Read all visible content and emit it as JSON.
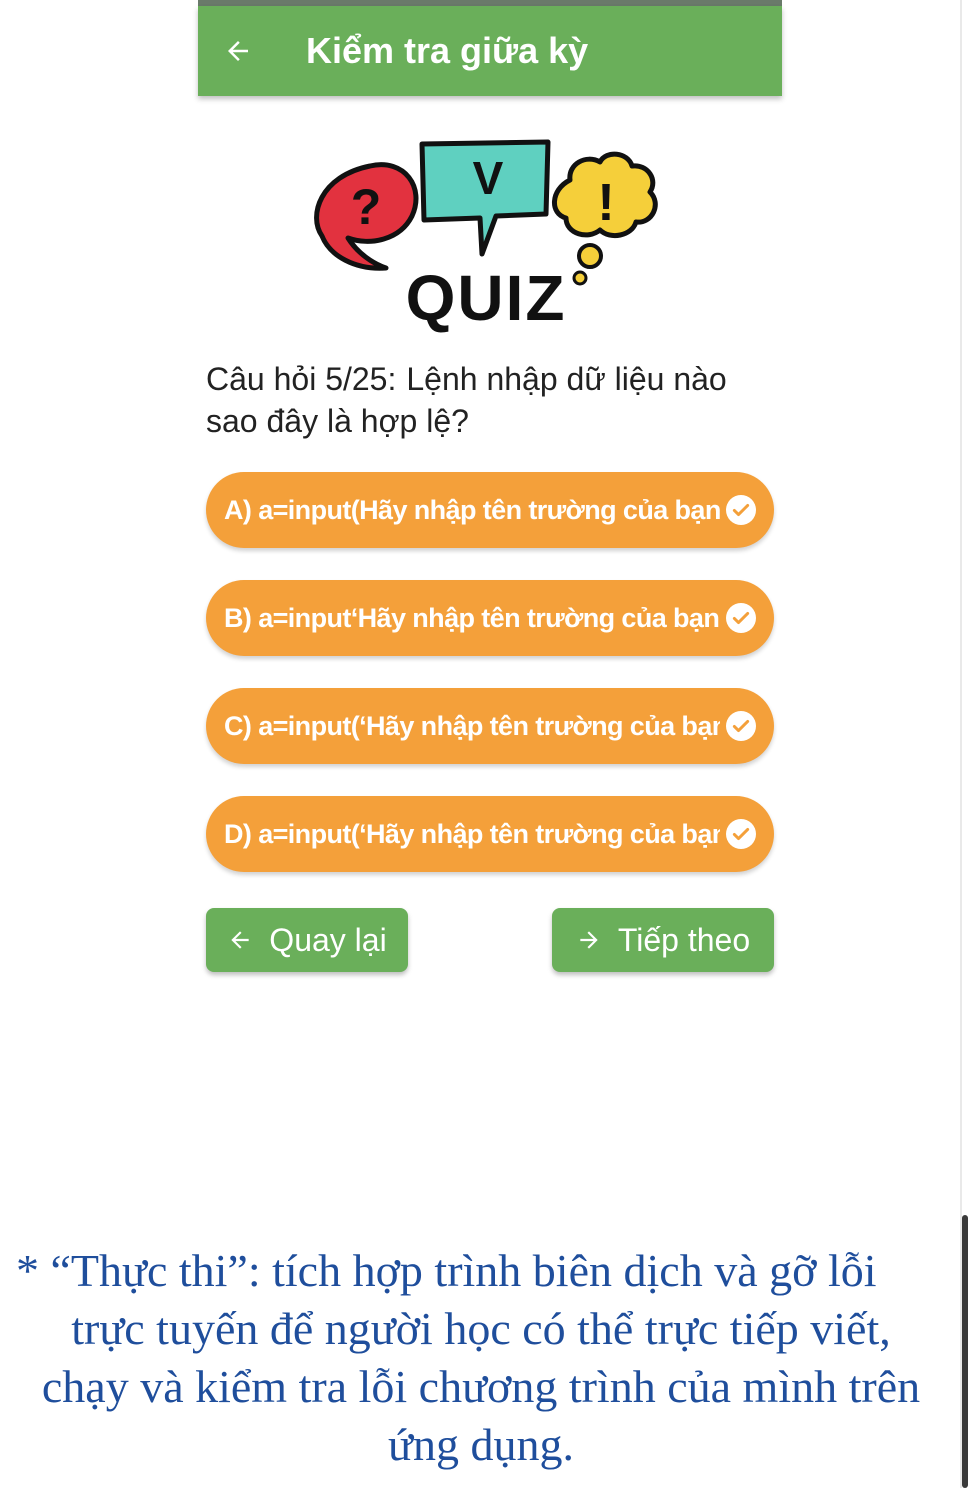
{
  "appbar": {
    "title": "Kiểm tra giữa kỳ",
    "back_icon": "arrow-left-icon",
    "color": "#6aaf5a"
  },
  "logo": {
    "word": "QUIZ",
    "bubble_left_glyph": "?",
    "bubble_center_glyph": "V",
    "bubble_right_glyph": "!"
  },
  "question": {
    "number": "Câu hỏi 5/25:",
    "text": "Lệnh nhập dữ liệu nào sao đây là hợp lệ?"
  },
  "options": [
    {
      "label": "A) a=input(Hãy nhập tên trường của bạn:)"
    },
    {
      "label": "B) a=input‘Hãy nhập tên trường của bạn:’"
    },
    {
      "label": "C) a=input(‘Hãy nhập tên trường của bạn:’)"
    },
    {
      "label": "D) a=input(‘Hãy nhập tên trường của bạn:’);"
    }
  ],
  "option_color": "#f4a03a",
  "navigation": {
    "back_label": "Quay lại",
    "next_label": "Tiếp theo"
  },
  "caption": {
    "line1": "* “Thực thi”: tích hợp trình biên dịch và gỡ lỗi",
    "line2": "trực tuyến để người học có thể trực tiếp viết,",
    "line3": "chạy và kiểm tra lỗi chương trình của mình trên",
    "line4": "ứng dụng.",
    "color": "#1f4e9c"
  }
}
